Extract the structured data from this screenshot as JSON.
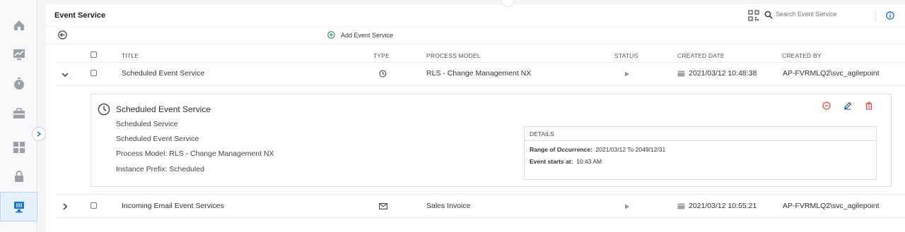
{
  "header": {
    "title": "Event Service",
    "search_placeholder": "Search Event Service"
  },
  "toolbar": {
    "add_label": "Add Event Service"
  },
  "columns": {
    "title": "TITLE",
    "type": "TYPE",
    "process_model": "PROCESS MODEL",
    "status": "STATUS",
    "created_date": "CREATED DATE",
    "created_by": "CREATED BY"
  },
  "rows": [
    {
      "title": "Scheduled Event Service",
      "type_icon": "clock-icon",
      "process_model": "RLS - Change Management NX",
      "status_icon": "play-icon",
      "created_date": "2021/03/12 10:48:38",
      "created_by": "AP-FVRMLQ2\\svc_agilepoint",
      "expanded": true
    },
    {
      "title": "Incoming Email Event Services",
      "type_icon": "mail-icon",
      "process_model": "Sales Invoice",
      "status_icon": "play-icon",
      "created_date": "2021/03/12 10:55:21",
      "created_by": "AP-FVRMLQ2\\svc_agilepoint",
      "expanded": false
    }
  ],
  "detail": {
    "title": "Scheduled Event Service",
    "lines": [
      "Scheduled Service",
      "Scheduled Event Service",
      "Process Model: RLS - Change Management NX",
      "Instance Prefix: Scheduled"
    ],
    "details_header": "DETAILS",
    "range_label": "Range of Occurrence:",
    "range_value": "2021/03/12 To 2049/12/31",
    "starts_label": "Event starts at:",
    "starts_value": "10:43 AM"
  },
  "sidebar": {
    "items": [
      "home-icon",
      "analytics-icon",
      "timer-icon",
      "briefcase-icon",
      "dashboard-icon",
      "lock-icon",
      "event-service-icon"
    ],
    "active_index": 6
  },
  "colors": {
    "accent": "#1a73c8",
    "add_green": "#2e9e5b",
    "danger": "#d94a4a",
    "status_play": "#9a8fb0",
    "muted_icon": "#9aa0a6"
  }
}
